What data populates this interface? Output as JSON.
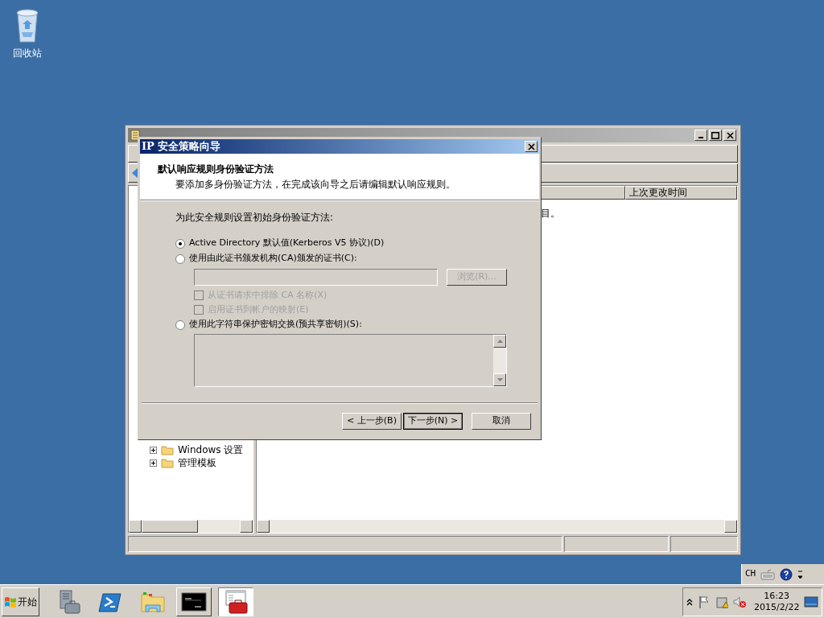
{
  "desktop": {
    "icons": [
      {
        "label": "回收站"
      }
    ]
  },
  "main_window": {
    "list_columns": [
      "上次更改时间"
    ],
    "list_text": "目。",
    "tree": [
      {
        "label": "Windows 设置",
        "expanded": false
      },
      {
        "label": "管理模板",
        "expanded": false
      }
    ]
  },
  "dialog": {
    "title": "IP 安全策略向导",
    "heading": "默认响应规则身份验证方法",
    "subheading": "要添加多身份验证方法，在完成该向导之后请编辑默认响应规则。",
    "prompt": "为此安全规则设置初始身份验证方法:",
    "options": [
      {
        "kind": "radio",
        "label": "Active Directory 默认值(Kerberos V5 协议)(D)",
        "selected": true
      },
      {
        "kind": "radio",
        "label": "使用由此证书颁发机构(CA)颁发的证书(C):",
        "selected": false
      },
      {
        "kind": "picker",
        "browse": "浏览(R)...",
        "disabled": true
      },
      {
        "kind": "checkbox",
        "label": "从证书请求中排除 CA 名称(X)",
        "checked": false,
        "disabled": true
      },
      {
        "kind": "checkbox",
        "label": "启用证书到帐户的映射(E)",
        "checked": false,
        "disabled": true
      },
      {
        "kind": "radio",
        "label": "使用此字符串保护密钥交换(预共享密钥)(S):",
        "selected": false
      },
      {
        "kind": "textbox"
      }
    ],
    "buttons": [
      {
        "label": "< 上一步(B)",
        "default": false
      },
      {
        "label": "下一步(N) >",
        "default": true
      },
      {
        "label": "取消",
        "default": false
      }
    ]
  },
  "taskbar": {
    "start": "开始",
    "apps": [
      {
        "kind": "server",
        "running": false,
        "selected": false
      },
      {
        "kind": "powershell",
        "running": false,
        "selected": false
      },
      {
        "kind": "explorer",
        "running": false,
        "selected": false
      },
      {
        "kind": "console",
        "running": true,
        "selected": false
      },
      {
        "kind": "toolbox",
        "running": true,
        "selected": true
      }
    ],
    "language": "CH",
    "time": "16:23",
    "date": "2015/2/22"
  }
}
